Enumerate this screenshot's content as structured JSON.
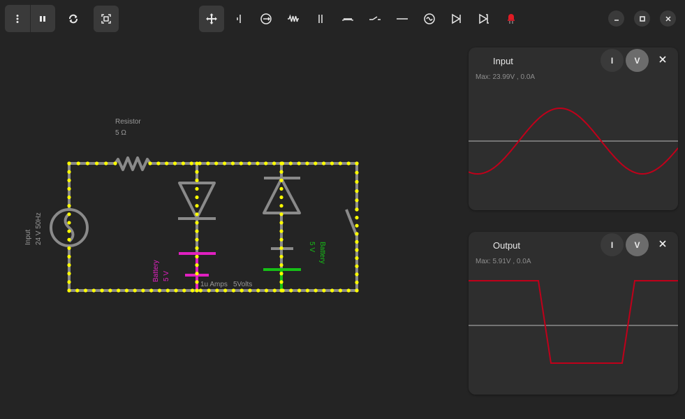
{
  "toolbar": {
    "left": [
      {
        "name": "menu",
        "icon": "menu-icon"
      },
      {
        "name": "pause",
        "icon": "pause-icon"
      },
      {
        "name": "refresh",
        "icon": "refresh-icon"
      },
      {
        "name": "fit",
        "icon": "fit-view-icon"
      }
    ],
    "tools": [
      {
        "name": "move",
        "icon": "move-icon",
        "active": true
      },
      {
        "name": "wire-probe",
        "icon": "ammeter-icon"
      },
      {
        "name": "current-source",
        "icon": "current-source-icon"
      },
      {
        "name": "resistor",
        "icon": "resistor-icon"
      },
      {
        "name": "capacitor",
        "icon": "capacitor-icon"
      },
      {
        "name": "inductor",
        "icon": "inductor-icon"
      },
      {
        "name": "switch",
        "icon": "switch-icon"
      },
      {
        "name": "wire",
        "icon": "wire-icon"
      },
      {
        "name": "ac-source",
        "icon": "ac-source-icon"
      },
      {
        "name": "diode",
        "icon": "diode-icon"
      },
      {
        "name": "zener-diode",
        "icon": "zener-diode-icon"
      },
      {
        "name": "led",
        "icon": "led-icon"
      }
    ],
    "window": [
      "minimize",
      "maximize",
      "close"
    ]
  },
  "circuit": {
    "resistor": {
      "name": "Resistor",
      "value": "5 Ω"
    },
    "source": {
      "name": "Input",
      "value": "24 V 50Hz"
    },
    "battery1": {
      "name": "Battery",
      "value": "5 V",
      "color": "#e020c0"
    },
    "battery2": {
      "name": "Battery",
      "value": "5 V",
      "color": "#16c016"
    },
    "readout": {
      "current": "1u Amps",
      "voltage": "5Volts"
    },
    "colors": {
      "wire": "#8a8a8a",
      "dot": "#ffff00",
      "background": "#242424"
    }
  },
  "panels": [
    {
      "title": "Input",
      "max": "Max: 23.99V , 0.0A",
      "btn_i": "I",
      "btn_v": "V",
      "chart_data": {
        "type": "line",
        "series": [
          {
            "name": "V",
            "shape": "sine"
          }
        ],
        "color": "#c0001a"
      }
    },
    {
      "title": "Output",
      "max": "Max: 5.91V , 0.0A",
      "btn_i": "I",
      "btn_v": "V",
      "chart_data": {
        "type": "line",
        "series": [
          {
            "name": "V",
            "shape": "clipped"
          }
        ],
        "color": "#c0001a"
      }
    }
  ]
}
